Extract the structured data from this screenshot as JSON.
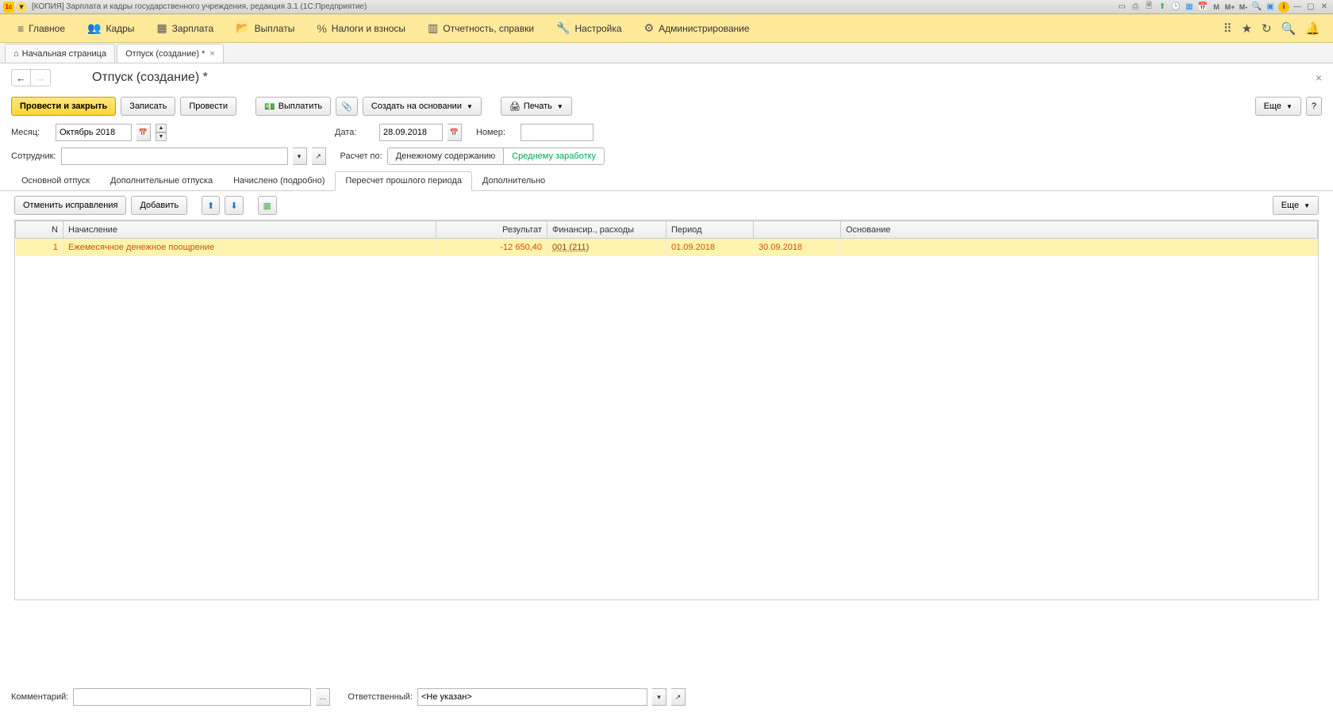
{
  "titlebar": {
    "app_badge": "1c",
    "title": "[КОПИЯ] Зарплата и кадры государственного учреждения, редакция 3.1  (1С:Предприятие)",
    "m_labels": [
      "M",
      "M+",
      "M-"
    ]
  },
  "mainmenu": {
    "items": [
      {
        "icon": "≡",
        "label": "Главное"
      },
      {
        "icon": "👥",
        "label": "Кадры"
      },
      {
        "icon": "▦",
        "label": "Зарплата"
      },
      {
        "icon": "📂",
        "label": "Выплаты"
      },
      {
        "icon": "%",
        "label": "Налоги и взносы"
      },
      {
        "icon": "▥",
        "label": "Отчетность, справки"
      },
      {
        "icon": "🔧",
        "label": "Настройка"
      },
      {
        "icon": "⚙",
        "label": "Администрирование"
      }
    ]
  },
  "tabs": {
    "home": "Начальная страница",
    "current": "Отпуск (создание) *"
  },
  "page": {
    "title": "Отпуск (создание) *"
  },
  "toolbar": {
    "post_close": "Провести и закрыть",
    "save": "Записать",
    "post": "Провести",
    "pay": "Выплатить",
    "create_based": "Создать на основании",
    "print": "Печать",
    "more": "Еще",
    "help": "?"
  },
  "form": {
    "month_label": "Месяц:",
    "month_value": "Октябрь 2018",
    "date_label": "Дата:",
    "date_value": "28.09.2018",
    "number_label": "Номер:",
    "number_value": "",
    "employee_label": "Сотрудник:",
    "employee_value": "",
    "calc_label": "Расчет по:",
    "calc_opt1": "Денежному содержанию",
    "calc_opt2": "Среднему заработку"
  },
  "inner_tabs": [
    "Основной отпуск",
    "Дополнительные отпуска",
    "Начислено (подробно)",
    "Пересчет прошлого периода",
    "Дополнительно"
  ],
  "sub_toolbar": {
    "cancel_fix": "Отменить исправления",
    "add": "Добавить",
    "more": "Еще"
  },
  "table": {
    "headers": {
      "n": "N",
      "accrual": "Начисление",
      "result": "Результат",
      "fin": "Финансир., расходы",
      "period": "Период",
      "basis": "Основание"
    },
    "rows": [
      {
        "n": "1",
        "accrual": "Ежемесячное денежное поощрение",
        "result": "-12 650,40",
        "fin": "001 (211)",
        "period_from": "01.09.2018",
        "period_to": "30.09.2018",
        "basis": ""
      }
    ]
  },
  "footer": {
    "comment_label": "Комментарий:",
    "comment_value": "",
    "resp_label": "Ответственный:",
    "resp_value": "<Не указан>"
  }
}
